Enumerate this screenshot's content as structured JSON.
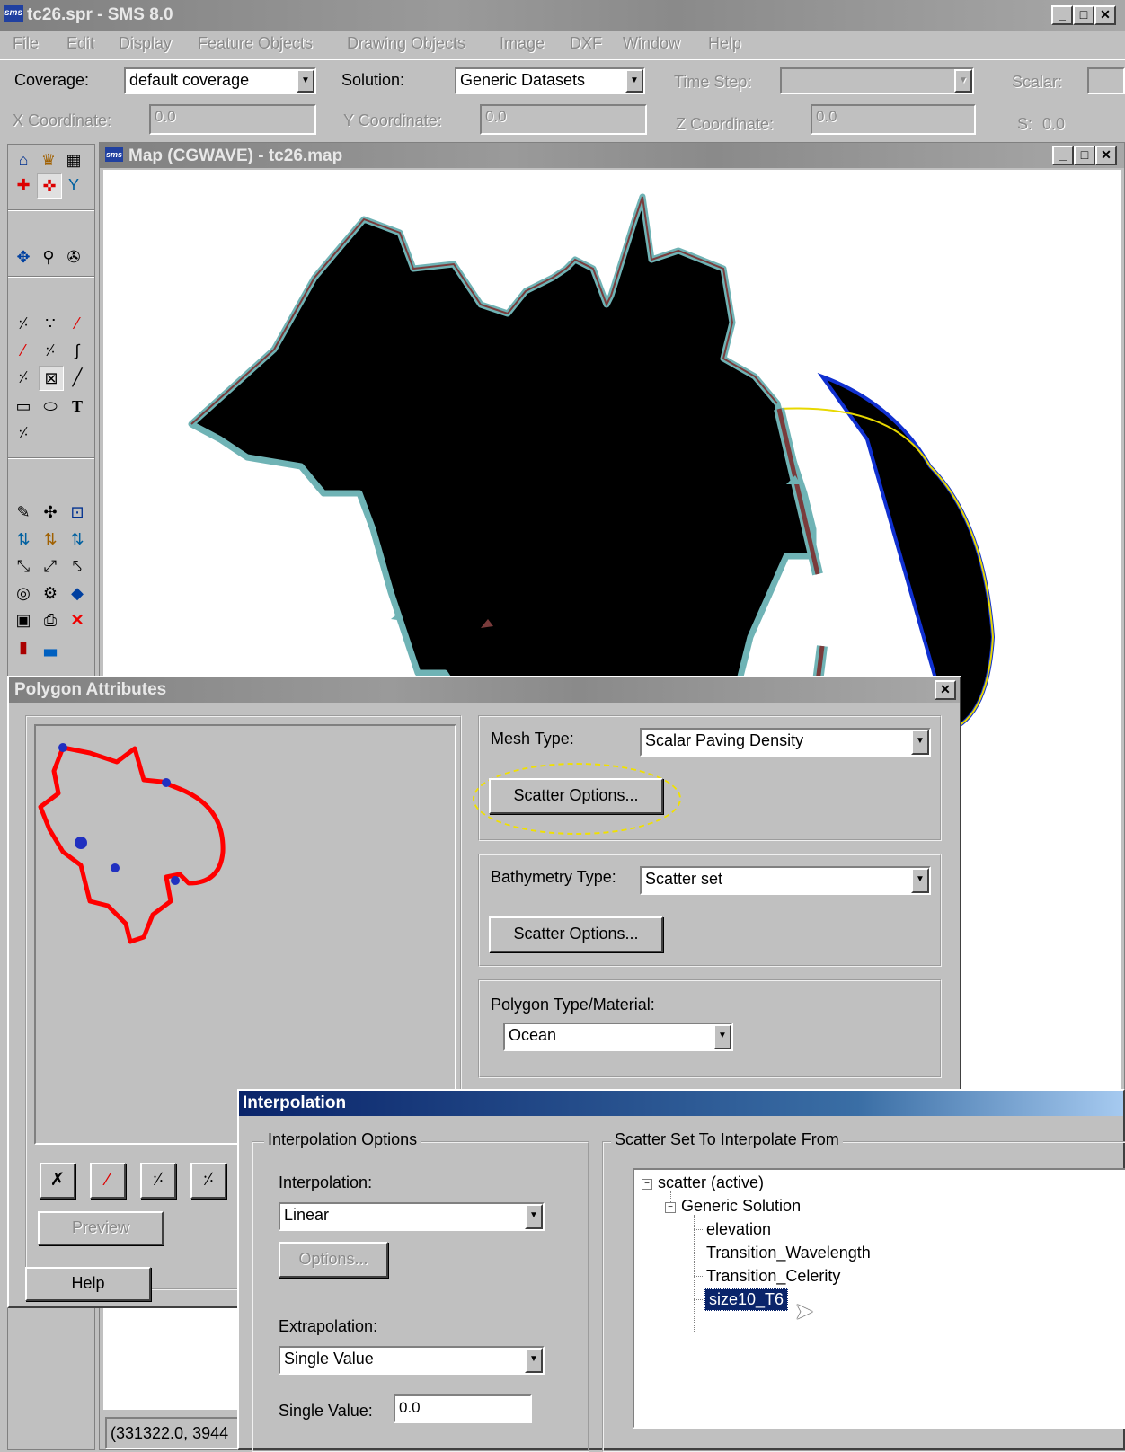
{
  "app": {
    "title": "tc26.spr - SMS 8.0",
    "icon": "sms-logo-icon"
  },
  "menu": [
    "File",
    "Edit",
    "Display",
    "Feature Objects",
    "Drawing Objects",
    "Image",
    "DXF",
    "Window",
    "Help"
  ],
  "toolbar1": {
    "coverage_label": "Coverage:",
    "coverage_value": "default coverage",
    "solution_label": "Solution:",
    "solution_value": "Generic Datasets",
    "timestep_label": "Time Step:",
    "timestep_value": "",
    "scalar_label": "Scalar:"
  },
  "toolbar2": {
    "x_label": "X Coordinate:",
    "x_value": "0.0",
    "y_label": "Y Coordinate:",
    "y_value": "0.0",
    "z_label": "Z Coordinate:",
    "z_value": "0.0",
    "s_label": "S:",
    "s_value": "0.0"
  },
  "map_window": {
    "title": "Map (CGWAVE) - tc26.map",
    "status": "(331322.0, 3944"
  },
  "polygon_dialog": {
    "title": "Polygon Attributes",
    "mesh_type_label": "Mesh Type:",
    "mesh_type_value": "Scalar Paving Density",
    "scatter_options_1": "Scatter Options...",
    "bathy_type_label": "Bathymetry Type:",
    "bathy_type_value": "Scatter set",
    "scatter_options_2": "Scatter Options...",
    "poly_type_label": "Polygon Type/Material:",
    "poly_type_value": "Ocean",
    "preview": "Preview",
    "help": "Help"
  },
  "interp_dialog": {
    "title": "Interpolation",
    "options_group": "Interpolation Options",
    "interp_label": "Interpolation:",
    "interp_value": "Linear",
    "options_btn": "Options...",
    "extrap_label": "Extrapolation:",
    "extrap_value": "Single Value",
    "single_label": "Single Value:",
    "single_value": "0.0",
    "scatter_group": "Scatter Set To Interpolate From",
    "tree": {
      "root": "scatter (active)",
      "solution": "Generic Solution",
      "datasets": [
        "elevation",
        "Transition_Wavelength",
        "Transition_Celerity",
        "size10_T6"
      ],
      "selected_index": 3
    }
  },
  "colors": {
    "accent": "#0a246a",
    "boundary": "#2f7fbf",
    "arc": "#7a3b3b",
    "poly_preview": "#ff0000"
  }
}
